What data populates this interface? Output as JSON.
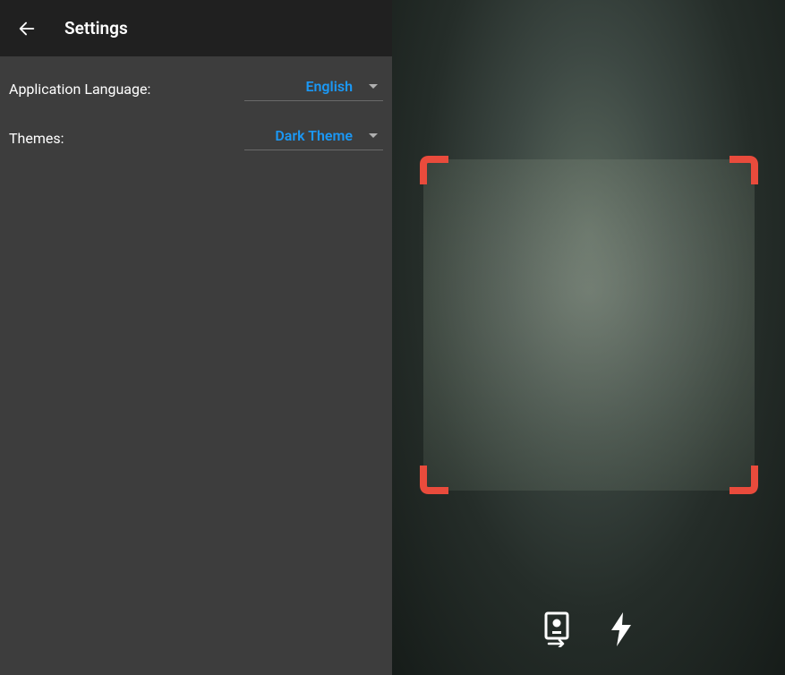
{
  "settings": {
    "header_title": "Settings",
    "rows": [
      {
        "label": "Application Language:",
        "value": "English"
      },
      {
        "label": "Themes:",
        "value": "Dark Theme"
      }
    ]
  },
  "colors": {
    "accent": "#1b98f5",
    "corner": "#e94b3c"
  }
}
